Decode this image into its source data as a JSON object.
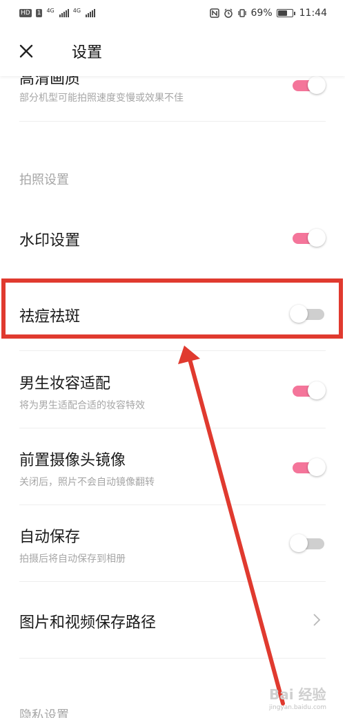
{
  "status_bar": {
    "hd_badge": "HD",
    "sim_number": "1",
    "network_1": "4G",
    "network_2": "4G",
    "battery_percent": "69%",
    "battery_level": 0.69,
    "time": "11:44"
  },
  "header": {
    "title": "设置"
  },
  "top_partial_item": {
    "title": "高清画质",
    "subtitle": "部分机型可能拍照速度变慢或效果不佳",
    "toggle_on": true
  },
  "section_photo": "拍照设置",
  "items": [
    {
      "title": "水印设置",
      "subtitle": "",
      "control": "toggle",
      "on": true
    },
    {
      "title": "祛痘祛斑",
      "subtitle": "",
      "control": "toggle",
      "on": false
    },
    {
      "title": "男生妆容适配",
      "subtitle": "将为男生适配合适的妆容特效",
      "control": "toggle",
      "on": true
    },
    {
      "title": "前置摄像头镜像",
      "subtitle": "关闭后，照片不会自动镜像翻转",
      "control": "toggle",
      "on": true
    },
    {
      "title": "自动保存",
      "subtitle": "拍摄后将自动保存到相册",
      "control": "toggle",
      "on": false
    },
    {
      "title": "图片和视频保存路径",
      "subtitle": "",
      "control": "chevron"
    }
  ],
  "section_privacy": "隐私设置",
  "watermark": {
    "text": "Bai 经验",
    "sub": "jingyan.baidu.com"
  },
  "colors": {
    "toggle_on": "#f4759a",
    "toggle_off": "#cfcfcf",
    "annotation": "#e03a2f"
  }
}
